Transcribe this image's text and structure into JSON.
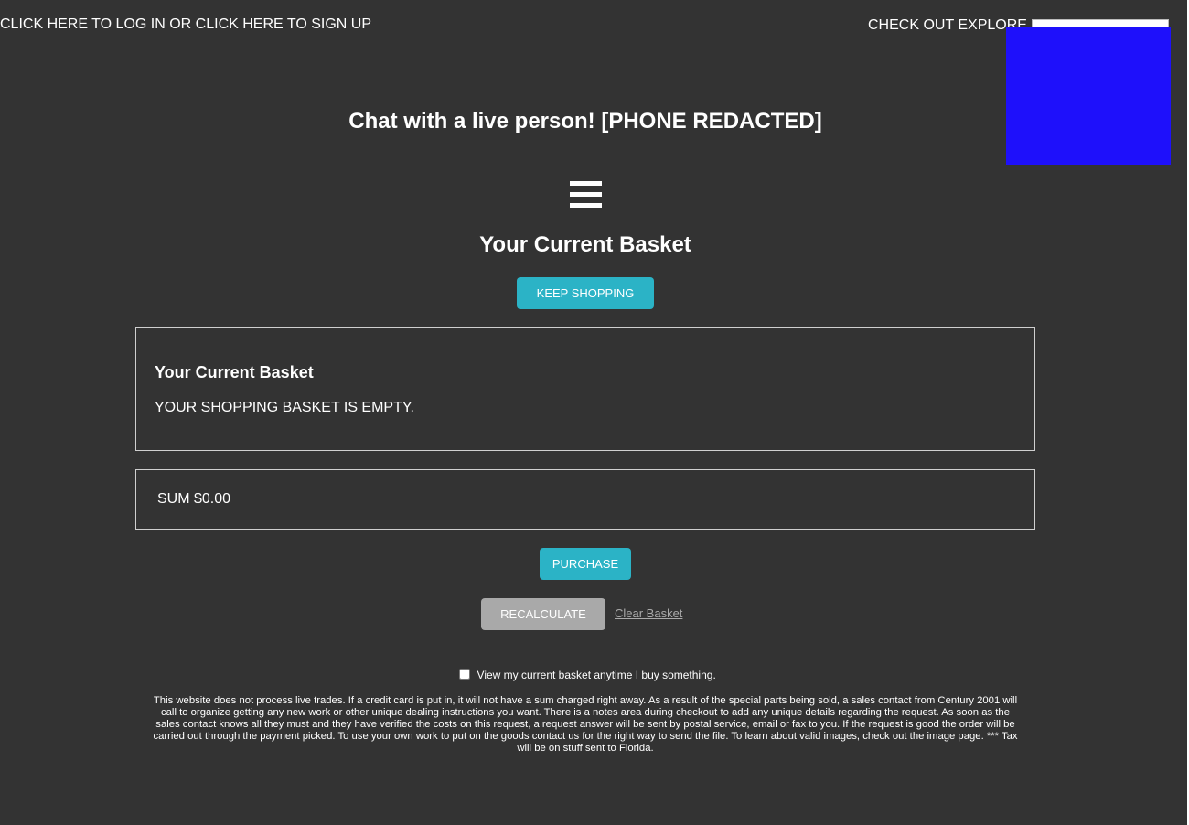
{
  "header": {
    "login_signup_text": "CLICK HERE TO LOG IN OR CLICK HERE TO SIGN UP",
    "explore_text": "CHECK OUT EXPLORE",
    "block_color": "#1e10fb"
  },
  "chat": {
    "text": "Chat with a live person! [PHONE REDACTED]"
  },
  "menu": {
    "icon": "hamburger-menu-icon"
  },
  "basket": {
    "heading": "Your Current Basket",
    "keep_shopping_label": "KEEP SHOPPING",
    "panel_title": "Your Current Basket",
    "empty_message": "YOUR SHOPPING BASKET IS EMPTY.",
    "sum_text": "SUM $0.00",
    "purchase_label": "PURCHASE",
    "recalculate_label": "RECALCULATE",
    "clear_label": "Clear Basket"
  },
  "options": {
    "view_basket_label": "View my current basket anytime I buy something.",
    "view_basket_checked": false
  },
  "disclaimer": "This website does not process live trades. If a credit card is put in, it will not have a sum charged right away. As a result of the special parts being sold, a sales contact from Century 2001 will call to organize getting any new work or other unique dealing instructions you want. There is a notes area during checkout to add any unique details regarding the request. As soon as the sales contact knows all they must and they have verified the costs on this request, a request answer will be sent by postal service, email or fax to you. If the request is good the order will be carried out through the payment picked. To use your own work to put on the goods contact us for the right way to send the file. To learn about valid images, check out the image page. *** Tax will be on stuff sent to Florida.",
  "colors": {
    "background": "#333333",
    "accent": "#2bb3c6",
    "secondary_button": "#a9a9a9"
  }
}
